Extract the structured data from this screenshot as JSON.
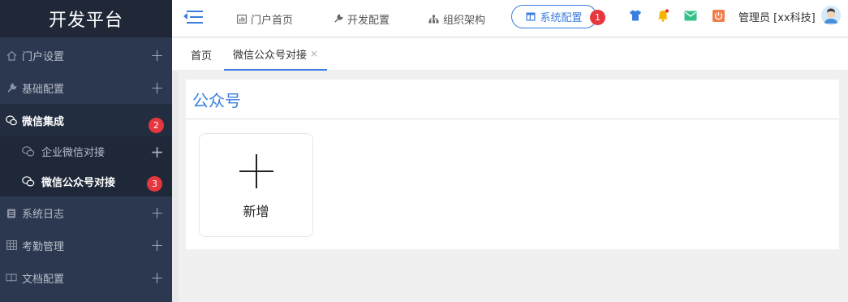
{
  "app": {
    "title": "开发平台"
  },
  "sidebar": {
    "items": [
      {
        "label": "门户设置",
        "icon": "home-icon"
      },
      {
        "label": "基础配置",
        "icon": "wrench-icon"
      },
      {
        "label": "微信集成",
        "icon": "wechat-icon",
        "badge": "2"
      },
      {
        "label": "系统日志",
        "icon": "clipboard-icon"
      },
      {
        "label": "考勤管理",
        "icon": "table-icon"
      },
      {
        "label": "文档配置",
        "icon": "book-icon"
      }
    ],
    "subitems": [
      {
        "label": "企业微信对接",
        "icon": "wechat-icon"
      },
      {
        "label": "微信公众号对接",
        "icon": "wechat-icon",
        "badge": "3"
      }
    ]
  },
  "topbar": {
    "nav": [
      {
        "label": "门户首页",
        "icon": "chart-icon"
      },
      {
        "label": "开发配置",
        "icon": "wrench-icon"
      },
      {
        "label": "组织架构",
        "icon": "org-icon"
      },
      {
        "label": "系统配置",
        "icon": "layout-icon",
        "badge": "1"
      }
    ],
    "user": "管理员 [xx科技]"
  },
  "tabs": [
    {
      "label": "首页"
    },
    {
      "label": "微信公众号对接",
      "close": "×"
    }
  ],
  "main": {
    "panel_title": "公众号",
    "add_label": "新增"
  },
  "colors": {
    "accent": "#3a7ee0",
    "sidebar_bg": "#2b3850",
    "badge": "#e5373d"
  }
}
